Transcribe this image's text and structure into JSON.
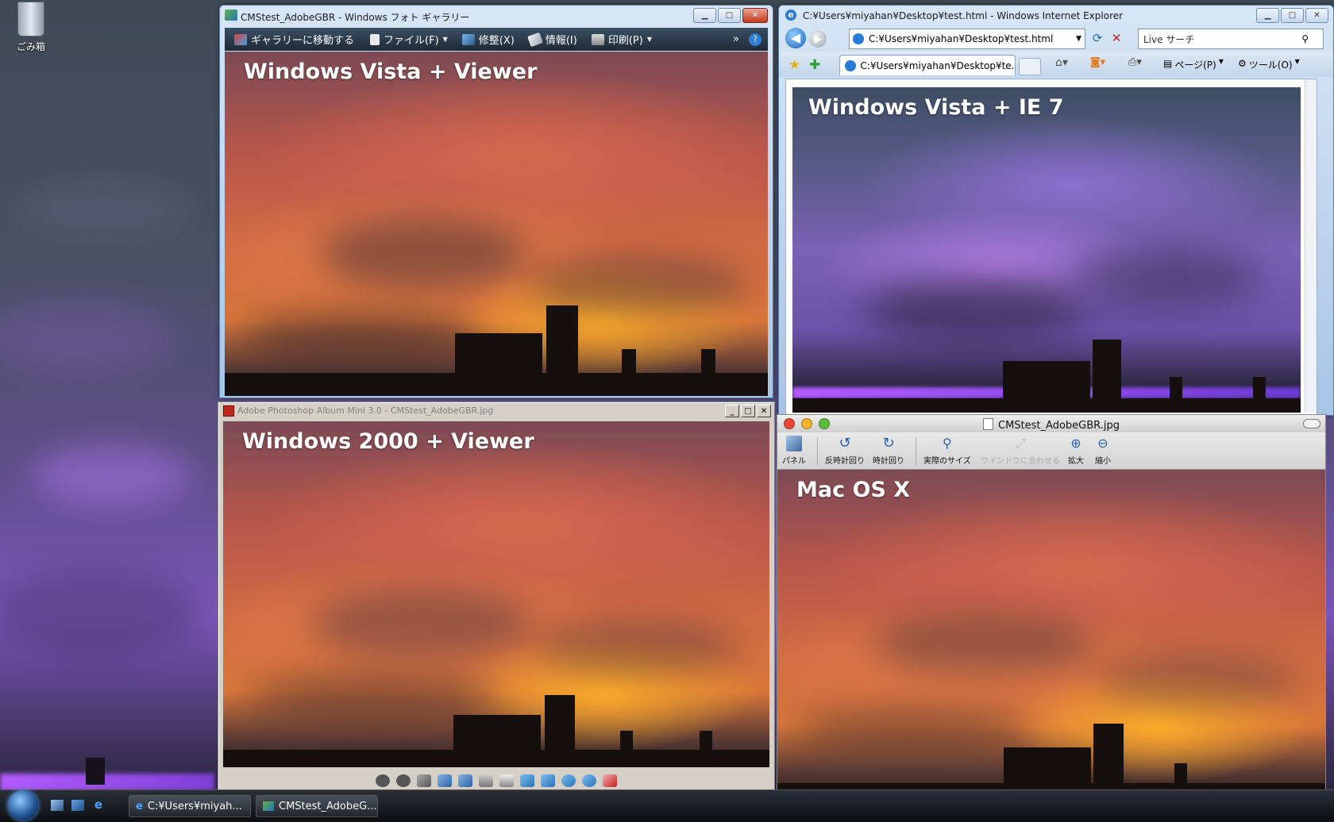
{
  "desktop": {
    "recycle_bin_label": "ごみ箱"
  },
  "photo_gallery": {
    "title": "CMStest_AdobeGBR - Windows フォト ギャラリー",
    "toolbar": {
      "gallery_link": "ギャラリーに移動する",
      "file": "ファイル(F)",
      "fix": "修整(X)",
      "info": "情報(I)",
      "print": "印刷(P)",
      "more": "»"
    },
    "photo_label": "Windows Vista + Viewer"
  },
  "ie": {
    "title": "C:¥Users¥miyahan¥Desktop¥test.html - Windows Internet Explorer",
    "address": "C:¥Users¥miyahan¥Desktop¥test.html",
    "search_placeholder": "Live サーチ",
    "tab_label": "C:¥Users¥miyahan¥Desktop¥te...",
    "page_menu": "ページ(P)",
    "tools_menu": "ツール(O)",
    "photo_label": "Windows Vista + IE 7"
  },
  "album_mini": {
    "title": "Adobe Photoshop Album Mini 3.0 - CMStest_AdobeGBR.jpg",
    "photo_label": "Windows 2000 + Viewer"
  },
  "mac_preview": {
    "title": "CMStest_AdobeGBR.jpg",
    "toolbar": {
      "panel": "パネル",
      "rotate_left": "反時計回り",
      "rotate_right": "時計回り",
      "actual_size": "実際のサイズ",
      "fit_window": "ウインドウに合わせる",
      "zoom_in": "拡大",
      "zoom_out": "縮小"
    },
    "photo_label": "Mac OS X"
  },
  "taskbar": {
    "items": [
      {
        "label": "C:¥Users¥miyah..."
      },
      {
        "label": "CMStest_AdobeG..."
      }
    ]
  }
}
